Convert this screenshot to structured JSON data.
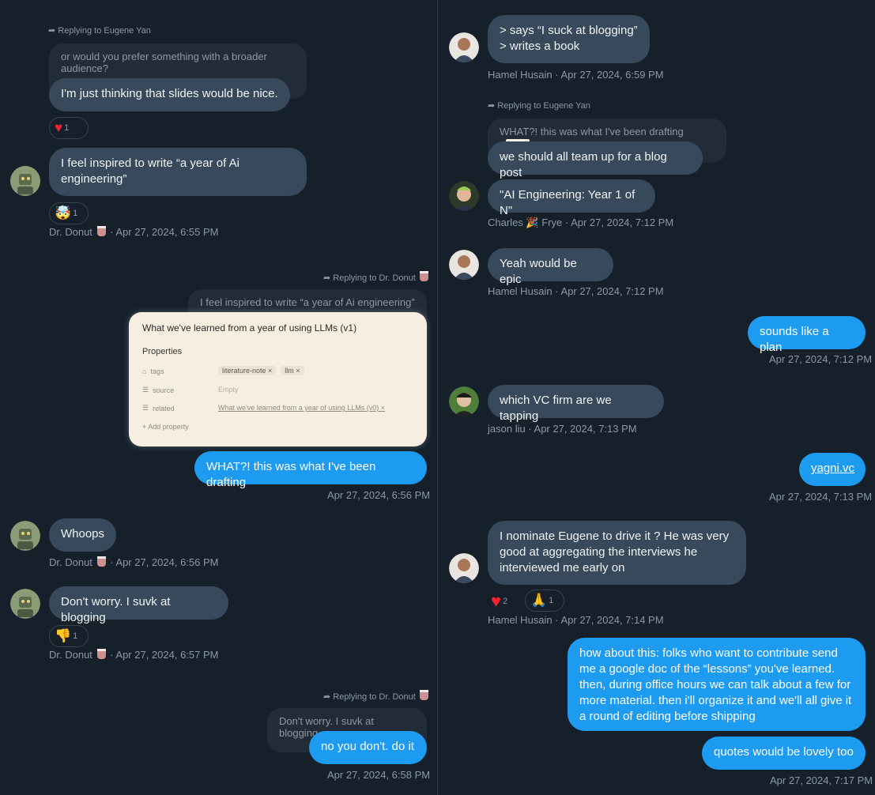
{
  "left": {
    "reply1": {
      "label": "Replying to Eugene Yan",
      "quoted": "or would you prefer something with a broader audience?",
      "message": "I'm just thinking that slides would be nice.",
      "reaction_count": "1"
    },
    "msg2": {
      "text": "I feel inspired to write “a year of Ai engineering”",
      "reaction_count": "1",
      "sender": "Dr. Donut",
      "time": "· Apr 27, 2024, 6:55 PM"
    },
    "reply2": {
      "label": "Replying to Dr. Donut",
      "quoted": "I feel inspired to write “a year of Ai engineering”",
      "card": {
        "title": "What we've learned from a year of using LLMs (v1)",
        "properties_label": "Properties",
        "rows": [
          {
            "key": "tags",
            "chips": [
              "literature-note ×",
              "llm ×"
            ]
          },
          {
            "key": "source",
            "value": "Empty"
          },
          {
            "key": "related",
            "value": "What we've learned from a year of using LLMs (v0) ×"
          }
        ],
        "add_property": "+ Add property"
      },
      "message": "WHAT?! this was what I've been drafting",
      "time": "Apr 27, 2024, 6:56 PM"
    },
    "msg3": {
      "text": "Whoops",
      "sender": "Dr. Donut",
      "time": "· Apr 27, 2024, 6:56 PM"
    },
    "msg4": {
      "text": "Don't worry. I suvk at blogging",
      "reaction_count": "1",
      "sender": "Dr. Donut",
      "time": "· Apr 27, 2024, 6:57 PM"
    },
    "reply3": {
      "label": "Replying to Dr. Donut",
      "quoted": "Don't worry. I suvk at blogging",
      "message": "no you don't. do it",
      "time": "Apr 27, 2024, 6:58 PM"
    }
  },
  "right": {
    "msg1": {
      "line1": "> says “I suck at blogging”",
      "line2": "> writes a book",
      "meta": "Hamel Husain · Apr 27, 2024, 6:59 PM"
    },
    "reply1": {
      "label": "Replying to Eugene Yan",
      "quoted": "WHAT?! this was what I've been drafting",
      "message": "we should all team up for a blog post"
    },
    "msg2": {
      "text": "\"AI Engineering: Year 1 of N\"",
      "sender_first": "Charles",
      "sender_last": "Frye",
      "time": "· Apr 27, 2024, 7:12 PM"
    },
    "msg3": {
      "text": "Yeah would be epic",
      "meta": "Hamel Husain · Apr 27, 2024, 7:12 PM"
    },
    "msg4": {
      "text": "sounds like a plan",
      "time": "Apr 27, 2024, 7:12 PM"
    },
    "msg5": {
      "text": "which VC firm are we tapping",
      "meta": "jason liu · Apr 27, 2024, 7:13 PM"
    },
    "msg6": {
      "text": "yagni.vc",
      "time": "Apr 27, 2024, 7:13 PM"
    },
    "msg7": {
      "text": "I nominate Eugene to drive it ?  He was very good at aggregating the interviews he interviewed me early on",
      "heart_count": "2",
      "pray_count": "1",
      "meta": "Hamel Husain · Apr 27, 2024, 7:14 PM"
    },
    "msg8": {
      "text": "how about this: folks who want to contribute send me a google doc of the “lessons” you've learned. then, during office hours we can talk about a few for more material. then i'll organize it and we'll all give it a round of editing before shipping"
    },
    "msg9": {
      "text": "quotes would be lovely too",
      "time": "Apr 27, 2024, 7:17 PM"
    }
  },
  "colors": {
    "background": "#15202b",
    "bubble_gray": "#37495a",
    "bubble_blue": "#1d9bf0",
    "meta": "#8b98a5"
  },
  "icons": [
    "reply-arrow-icon",
    "heart-icon",
    "mind-blown-icon",
    "thumbs-down-icon",
    "praying-hands-icon",
    "party-popper-icon",
    "cup-icon",
    "tag-icon",
    "list-icon"
  ]
}
